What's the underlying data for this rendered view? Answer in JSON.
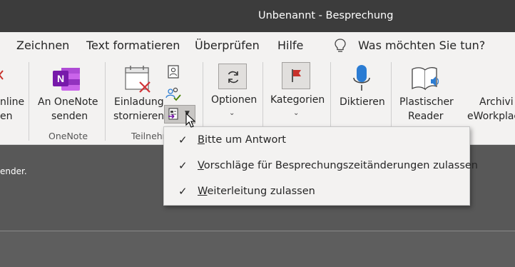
{
  "window": {
    "title": "Unbenannt  -  Besprechung"
  },
  "menubar": {
    "items": [
      "Zeichnen",
      "Text formatieren",
      "Überprüfen",
      "Hilfe"
    ],
    "tell_me": "Was möchten Sie tun?"
  },
  "ribbon": {
    "groups": {
      "left_partial": {
        "line1": "nline",
        "line2": "en"
      },
      "onenote": {
        "button_line1": "An OneNote",
        "button_line2": "senden",
        "group_label": "OneNote"
      },
      "teilnehmer": {
        "button_line1": "Einladung",
        "button_line2": "stornieren",
        "group_label": "Teilnehm"
      },
      "optionen": {
        "label": "Optionen"
      },
      "kategorien": {
        "label": "Kategorien"
      },
      "diktieren": {
        "label": "Diktieren"
      },
      "plastischer": {
        "line1": "Plastischer",
        "line2": "Reader"
      },
      "archivieren": {
        "line1": "Archivi",
        "line2": "eWorkplac"
      }
    }
  },
  "dropdown": {
    "items": [
      {
        "prefix": "B",
        "rest": "itte um Antwort",
        "checked": true
      },
      {
        "prefix": "V",
        "rest": "orschläge für Besprechungszeitänderungen zulassen",
        "checked": true
      },
      {
        "prefix": "W",
        "rest": "eiterleitung zulassen",
        "checked": true
      }
    ]
  },
  "body": {
    "snippet": "ender."
  },
  "colors": {
    "onenote_purple": "#7719aa",
    "dictate_blue": "#2b7cd3",
    "flag_red": "#c8322b",
    "titlebar": "#3c3c3c"
  }
}
